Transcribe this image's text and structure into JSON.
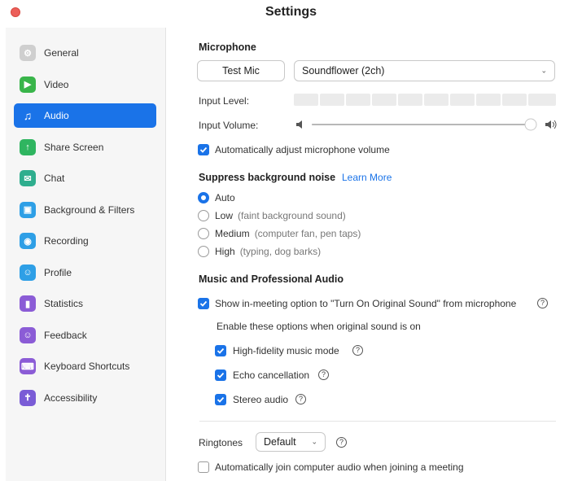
{
  "window": {
    "title": "Settings"
  },
  "sidebar": {
    "items": [
      {
        "label": "General",
        "icon": "gear-icon",
        "color": "#cfcfcf",
        "glyph": "⚙"
      },
      {
        "label": "Video",
        "icon": "video-camera-icon",
        "color": "#39b54a",
        "glyph": "▶"
      },
      {
        "label": "Audio",
        "icon": "headphones-icon",
        "color": "#1a73e8",
        "glyph": "♫"
      },
      {
        "label": "Share Screen",
        "icon": "share-screen-icon",
        "color": "#2fb560",
        "glyph": "↑"
      },
      {
        "label": "Chat",
        "icon": "chat-icon",
        "color": "#2fae8e",
        "glyph": "✉"
      },
      {
        "label": "Background & Filters",
        "icon": "background-icon",
        "color": "#2e9fe6",
        "glyph": "▣"
      },
      {
        "label": "Recording",
        "icon": "recording-icon",
        "color": "#2e9fe6",
        "glyph": "◉"
      },
      {
        "label": "Profile",
        "icon": "profile-icon",
        "color": "#2e9fe6",
        "glyph": "☺"
      },
      {
        "label": "Statistics",
        "icon": "statistics-icon",
        "color": "#8b5cd6",
        "glyph": "▮"
      },
      {
        "label": "Feedback",
        "icon": "feedback-icon",
        "color": "#8b5cd6",
        "glyph": "☺"
      },
      {
        "label": "Keyboard Shortcuts",
        "icon": "keyboard-icon",
        "color": "#8b5cd6",
        "glyph": "⌨"
      },
      {
        "label": "Accessibility",
        "icon": "accessibility-icon",
        "color": "#7a5cd6",
        "glyph": "✝"
      }
    ],
    "active_index": 2,
    "accent": "#1a73e8"
  },
  "microphone": {
    "title": "Microphone",
    "test_button": "Test Mic",
    "device": "Soundflower (2ch)",
    "input_level_label": "Input Level:",
    "input_volume_label": "Input Volume:",
    "input_volume_value": 1.0,
    "auto_adjust_label": "Automatically adjust microphone volume",
    "auto_adjust_checked": true
  },
  "noise": {
    "title": "Suppress background noise",
    "learn_more": "Learn More",
    "options": [
      {
        "label": "Auto",
        "hint": "",
        "selected": true
      },
      {
        "label": "Low",
        "hint": "(faint background sound)",
        "selected": false
      },
      {
        "label": "Medium",
        "hint": "(computer fan, pen taps)",
        "selected": false
      },
      {
        "label": "High",
        "hint": "(typing, dog barks)",
        "selected": false
      }
    ]
  },
  "music": {
    "title": "Music and Professional Audio",
    "show_original_sound_label": "Show in-meeting option to \"Turn On Original Sound\" from microphone",
    "enable_text": "Enable these options when original sound is on",
    "hifi_label": "High-fidelity music mode",
    "echo_label": "Echo cancellation",
    "stereo_label": "Stereo audio"
  },
  "ringtones": {
    "label": "Ringtones",
    "value": "Default"
  },
  "auto_join": {
    "label": "Automatically join computer audio when joining a meeting",
    "checked": false
  }
}
